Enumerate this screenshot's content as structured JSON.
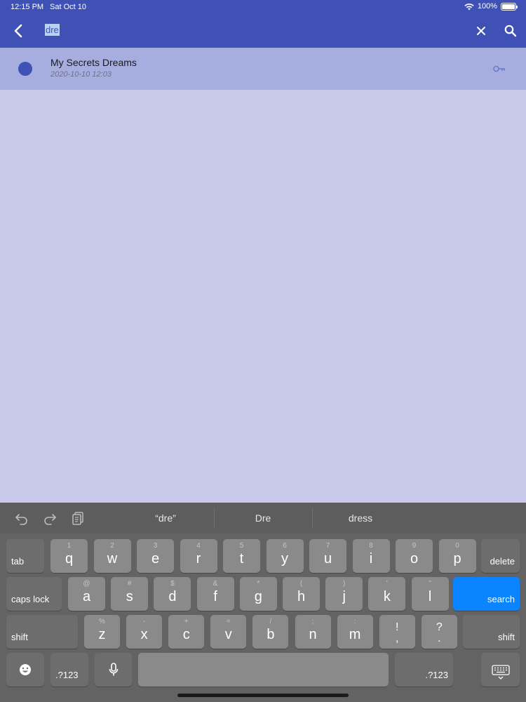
{
  "status_bar": {
    "time": "12:15 PM",
    "date": "Sat Oct 10",
    "battery": "100%"
  },
  "search": {
    "query": "dre"
  },
  "results": [
    {
      "title": "My Secrets Dreams",
      "date": "2020-10-10 12:03"
    }
  ],
  "keyboard": {
    "suggestions": [
      "“dre”",
      "Dre",
      "dress"
    ],
    "row1": [
      {
        "main": "q",
        "alt": "1"
      },
      {
        "main": "w",
        "alt": "2"
      },
      {
        "main": "e",
        "alt": "3"
      },
      {
        "main": "r",
        "alt": "4"
      },
      {
        "main": "t",
        "alt": "5"
      },
      {
        "main": "y",
        "alt": "6"
      },
      {
        "main": "u",
        "alt": "7"
      },
      {
        "main": "i",
        "alt": "8"
      },
      {
        "main": "o",
        "alt": "9"
      },
      {
        "main": "p",
        "alt": "0"
      }
    ],
    "row2": [
      {
        "main": "a",
        "alt": "@"
      },
      {
        "main": "s",
        "alt": "#"
      },
      {
        "main": "d",
        "alt": "$"
      },
      {
        "main": "f",
        "alt": "&"
      },
      {
        "main": "g",
        "alt": "*"
      },
      {
        "main": "h",
        "alt": "("
      },
      {
        "main": "j",
        "alt": ")"
      },
      {
        "main": "k",
        "alt": "'"
      },
      {
        "main": "l",
        "alt": "\""
      }
    ],
    "row3": [
      {
        "main": "z",
        "alt": "%"
      },
      {
        "main": "x",
        "alt": "-"
      },
      {
        "main": "c",
        "alt": "+"
      },
      {
        "main": "v",
        "alt": "="
      },
      {
        "main": "b",
        "alt": "/"
      },
      {
        "main": "n",
        "alt": ";"
      },
      {
        "main": "m",
        "alt": ":"
      },
      {
        "main": "!",
        "alt": "!"
      },
      {
        "main": "?",
        "alt": "?"
      }
    ],
    "row3_punct": [
      ",",
      "."
    ],
    "labels": {
      "tab": "tab",
      "delete": "delete",
      "caps_lock": "caps lock",
      "search": "search",
      "shift_left": "shift",
      "shift_right": "shift",
      "numbers_left": ".?123",
      "numbers_right": ".?123"
    }
  },
  "colors": {
    "header": "#3f51b5",
    "background": "#c8c9ea",
    "row_highlight": "#a6aedf",
    "search_key": "#0a84ff"
  }
}
